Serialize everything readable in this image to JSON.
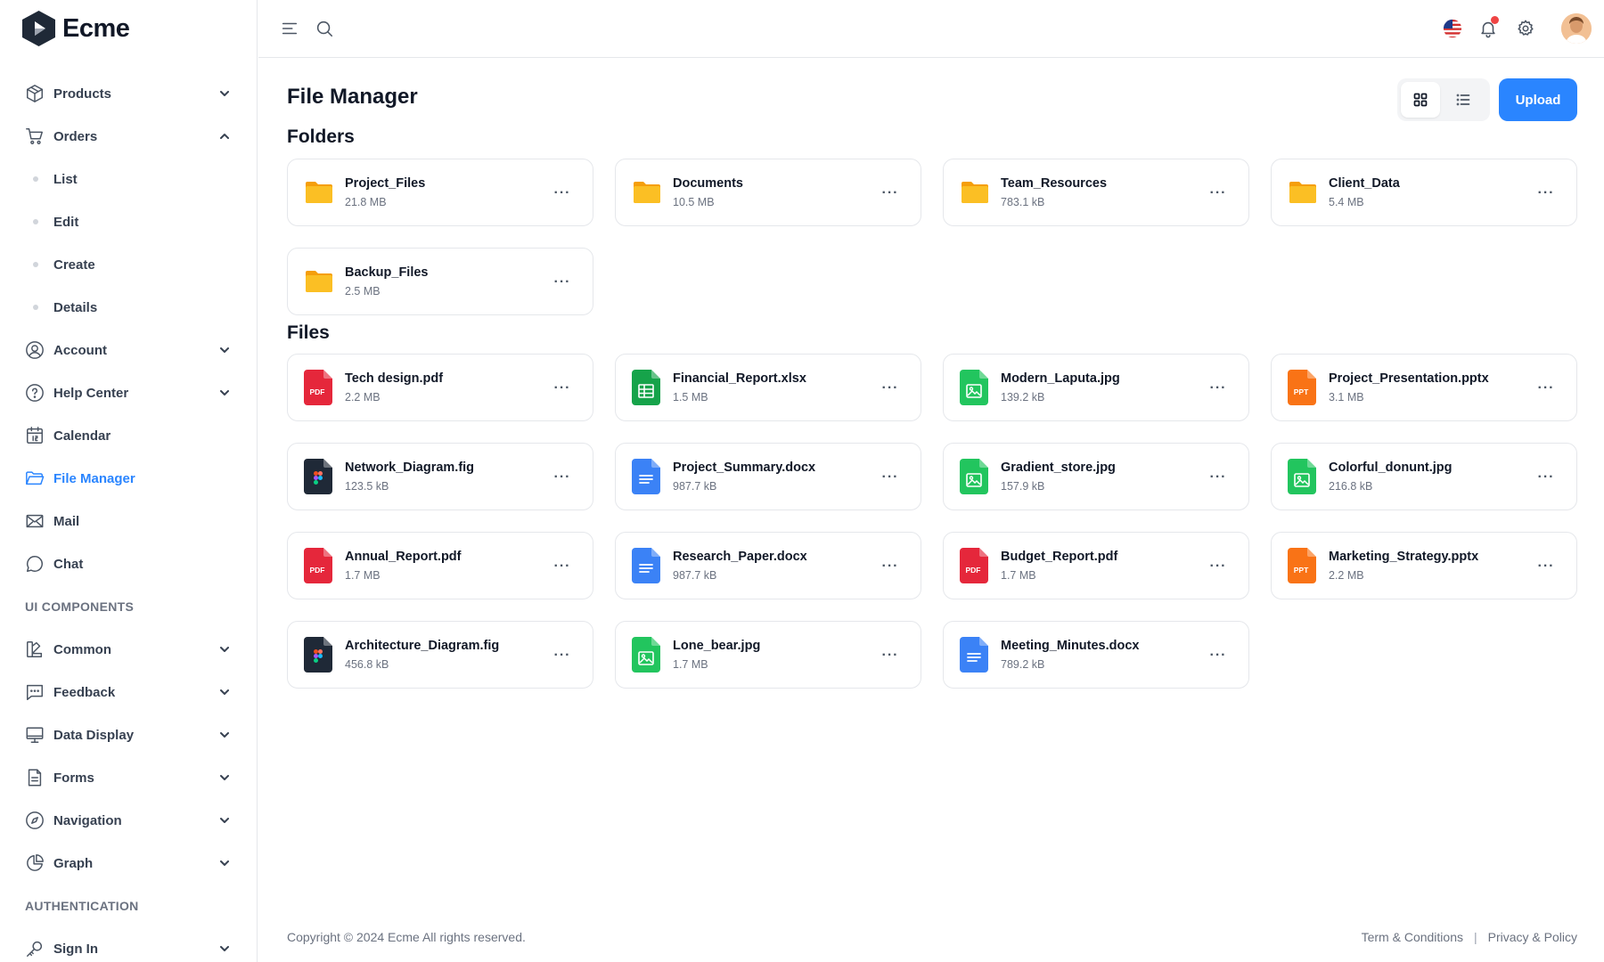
{
  "brand": {
    "name": "Ecme",
    "logo_icon": "ecme-logo"
  },
  "sidebar": {
    "items": [
      {
        "label": "Products",
        "icon": "box-icon",
        "chevron": "down"
      },
      {
        "label": "Orders",
        "icon": "cart-icon",
        "chevron": "up",
        "children": [
          "List",
          "Edit",
          "Create",
          "Details"
        ]
      },
      {
        "label": "Account",
        "icon": "user-circle-icon",
        "chevron": "down"
      },
      {
        "label": "Help Center",
        "icon": "help-circle-icon",
        "chevron": "down"
      },
      {
        "label": "Calendar",
        "icon": "calendar-icon"
      },
      {
        "label": "File Manager",
        "icon": "folder-icon",
        "active": true
      },
      {
        "label": "Mail",
        "icon": "mail-icon"
      },
      {
        "label": "Chat",
        "icon": "chat-icon"
      }
    ],
    "ui_components_label": "UI COMPONENTS",
    "ui_components": [
      {
        "label": "Common",
        "icon": "swatch-icon",
        "chevron": "down"
      },
      {
        "label": "Feedback",
        "icon": "message-icon",
        "chevron": "down"
      },
      {
        "label": "Data Display",
        "icon": "monitor-icon",
        "chevron": "down"
      },
      {
        "label": "Forms",
        "icon": "form-icon",
        "chevron": "down"
      },
      {
        "label": "Navigation",
        "icon": "compass-icon",
        "chevron": "down"
      },
      {
        "label": "Graph",
        "icon": "pie-icon",
        "chevron": "down"
      }
    ],
    "authentication_label": "AUTHENTICATION",
    "authentication": [
      {
        "label": "Sign In",
        "icon": "key-icon",
        "chevron": "down"
      }
    ]
  },
  "header": {
    "icons": [
      "menu-icon",
      "search-icon",
      "us-flag-icon",
      "bell-icon",
      "gear-icon",
      "avatar"
    ]
  },
  "page": {
    "title": "File Manager",
    "upload_label": "Upload",
    "view_mode": "grid",
    "folders_title": "Folders",
    "files_title": "Files",
    "more_label": "···"
  },
  "folders": [
    {
      "name": "Project_Files",
      "size": "21.8 MB"
    },
    {
      "name": "Documents",
      "size": "10.5 MB"
    },
    {
      "name": "Team_Resources",
      "size": "783.1 kB"
    },
    {
      "name": "Client_Data",
      "size": "5.4 MB"
    },
    {
      "name": "Backup_Files",
      "size": "2.5 MB"
    }
  ],
  "files": [
    {
      "name": "Tech design.pdf",
      "size": "2.2 MB",
      "type": "pdf"
    },
    {
      "name": "Financial_Report.xlsx",
      "size": "1.5 MB",
      "type": "xlsx"
    },
    {
      "name": "Modern_Laputa.jpg",
      "size": "139.2 kB",
      "type": "jpg"
    },
    {
      "name": "Project_Presentation.pptx",
      "size": "3.1 MB",
      "type": "pptx"
    },
    {
      "name": "Network_Diagram.fig",
      "size": "123.5 kB",
      "type": "fig"
    },
    {
      "name": "Project_Summary.docx",
      "size": "987.7 kB",
      "type": "docx"
    },
    {
      "name": "Gradient_store.jpg",
      "size": "157.9 kB",
      "type": "jpg"
    },
    {
      "name": "Colorful_donunt.jpg",
      "size": "216.8 kB",
      "type": "jpg"
    },
    {
      "name": "Annual_Report.pdf",
      "size": "1.7 MB",
      "type": "pdf"
    },
    {
      "name": "Research_Paper.docx",
      "size": "987.7 kB",
      "type": "docx"
    },
    {
      "name": "Budget_Report.pdf",
      "size": "1.7 MB",
      "type": "pdf"
    },
    {
      "name": "Marketing_Strategy.pptx",
      "size": "2.2 MB",
      "type": "pptx"
    },
    {
      "name": "Architecture_Diagram.fig",
      "size": "456.8 kB",
      "type": "fig"
    },
    {
      "name": "Lone_bear.jpg",
      "size": "1.7 MB",
      "type": "jpg"
    },
    {
      "name": "Meeting_Minutes.docx",
      "size": "789.2 kB",
      "type": "docx"
    }
  ],
  "file_badges": {
    "pdf": "PDF",
    "pptx": "PPT"
  },
  "colors": {
    "accent": "#2a85ff",
    "folder": "#fbbf24",
    "pdf": "#e5273b",
    "xlsx": "#16a34a",
    "jpg": "#22c55e",
    "pptx": "#f97316",
    "docx": "#3b82f6",
    "fig": "#1f2937"
  },
  "footer": {
    "copyright": "Copyright © 2024 Ecme All rights reserved.",
    "terms": "Term & Conditions",
    "separator": "|",
    "privacy": "Privacy & Policy"
  }
}
